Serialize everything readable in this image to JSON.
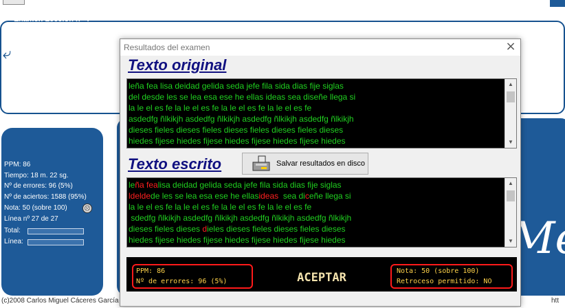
{
  "background": {
    "stats": {
      "title": "Examen Lección nº 4",
      "ppm": "PPM: 86",
      "time": "Tiempo: 18 m. 22 sg.",
      "errors": "Nº de errores: 96 (5%)",
      "hits": "Nº de aciertos: 1588 (95%)",
      "grade": "Nota: 50 (sobre 100)",
      "line": "Línea nº 27 de 27",
      "total_label": "Total:",
      "line_label": "Línea:"
    },
    "copyright": "(c)2008 Carlos Miguel Cáceres García",
    "copyright_right": "htt"
  },
  "dialog": {
    "title": "Resultados del examen",
    "original_heading": "Texto original",
    "written_heading": "Texto escrito",
    "save_button": "Salvar resultados en disco",
    "accept_button": "ACEPTAR",
    "original_lines": [
      "leña fea lisa deidad gelida seda jefe fila sida dias fije siglas",
      "del desde les se lea esa ese he ellas ideas sea diseñe llega si",
      "la le el es fe la le el es fe la le el es fe la le el es fe",
      "asdedfg ñlkikjh asdedfg ñlkikjh asdedfg ñlkikjh asdedfg ñlkikjh",
      "dieses fieles dieses fieles dieses fieles dieses fieles dieses",
      "hiedes fijese hiedes fijese hiedes fijese hiedes fijese hiedes"
    ],
    "written_lines": [
      [
        {
          "t": "le"
        },
        {
          "t": "ña fea",
          "err": true
        },
        {
          "t": "lisa deidad gelida seda jefe fila sida dias fije siglas"
        }
      ],
      [
        {
          "t": "ldelde",
          "err": true
        },
        {
          "t": "de les se lea esa ese he ellas"
        },
        {
          "t": "ideas",
          "err": true
        },
        {
          "t": "  sea di"
        },
        {
          "t": "c",
          "err": true
        },
        {
          "t": "eñe llega si"
        }
      ],
      [
        {
          "t": "la le el es fe la le el es fe la le el es fe la le el es fe"
        }
      ],
      [
        {
          "t": " sdedfg ñlkikjh asdedfg ñlkikjh asdedfg ñlkikjh asdedfg ñlkikjh"
        }
      ],
      [
        {
          "t": "dieses fieles dieses "
        },
        {
          "t": "d",
          "err": true
        },
        {
          "t": "ieles dieses fieles dieses fieles dieses"
        }
      ],
      [
        {
          "t": "hiedes fijese hiedes fijese hiedes fijese hiedes fijese hiedes"
        }
      ]
    ],
    "summary": {
      "ppm": "PPM: 86",
      "errors": "Nº de errores: 96 (5%)",
      "grade": "Nota: 50 (sobre 100)",
      "backtrack": "Retroceso permitido: NO"
    }
  }
}
